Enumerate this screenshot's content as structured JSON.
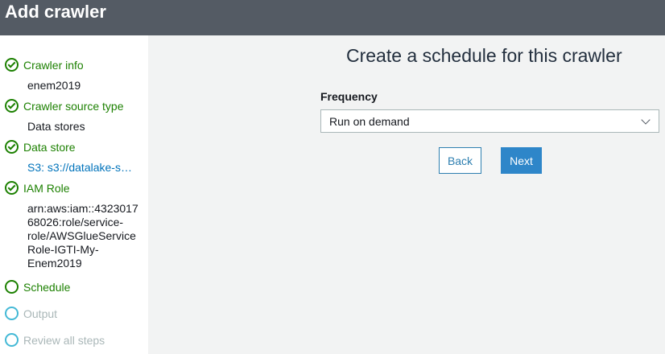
{
  "header": {
    "title": "Add crawler"
  },
  "sidebar": {
    "steps": [
      {
        "label": "Crawler info",
        "status": "done",
        "detail": "enem2019"
      },
      {
        "label": "Crawler source type",
        "status": "done",
        "detail": "Data stores"
      },
      {
        "label": "Data store",
        "status": "done",
        "detail": "S3: s3://datalake-s…"
      },
      {
        "label": "IAM Role",
        "status": "done",
        "detail_lines": [
          "arn:aws:iam::4323017",
          "68026:role/service-",
          "role/AWSGlueService",
          "Role-IGTI-My-",
          "Enem2019"
        ]
      },
      {
        "label": "Schedule",
        "status": "current"
      },
      {
        "label": "Output",
        "status": "pending"
      },
      {
        "label": "Review all steps",
        "status": "pending"
      }
    ]
  },
  "main": {
    "heading": "Create a schedule for this crawler",
    "frequency": {
      "label": "Frequency",
      "value": "Run on demand"
    },
    "buttons": {
      "back": "Back",
      "next": "Next"
    }
  },
  "colors": {
    "header_bg": "#545b64",
    "done_green": "#1d8102",
    "pending_blue": "#44b9d6",
    "primary_button": "#2e86c9"
  }
}
